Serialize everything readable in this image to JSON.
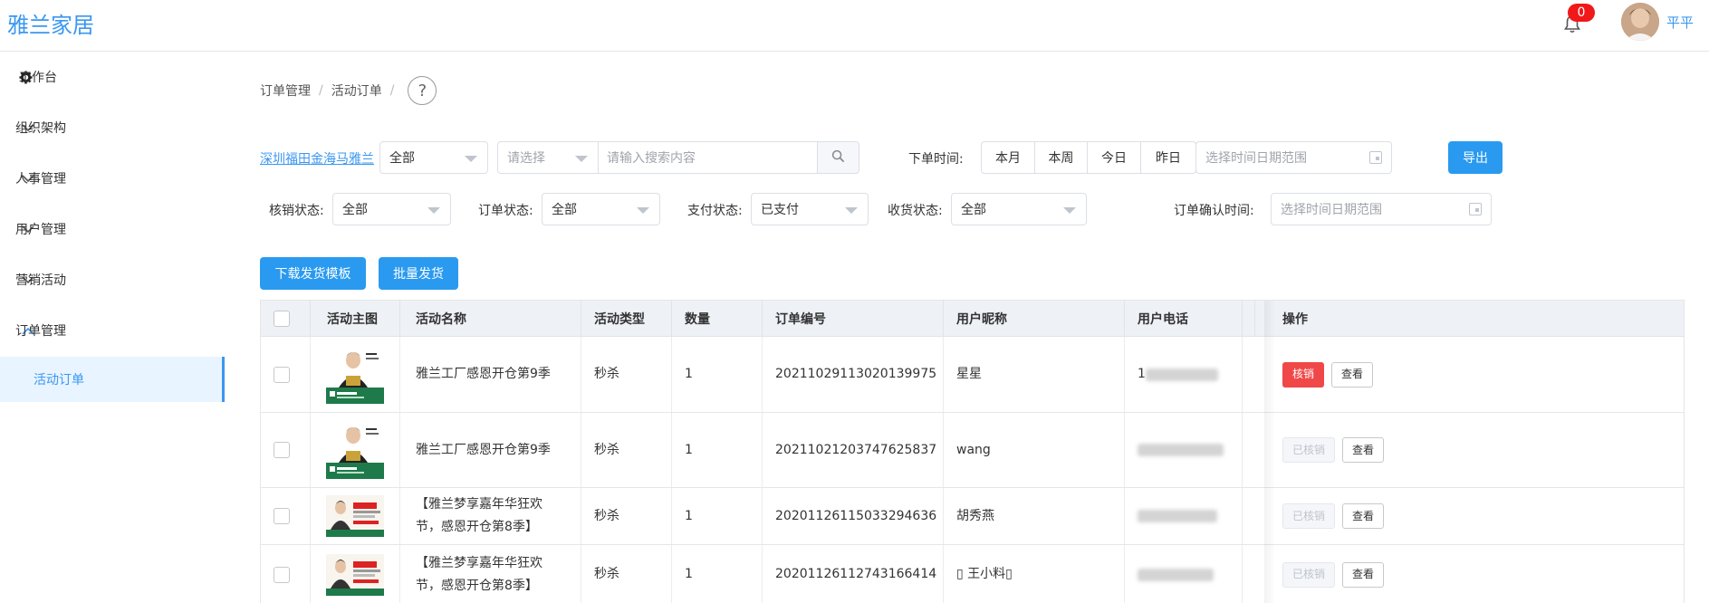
{
  "app": {
    "title": "雅兰家居",
    "notifications": "0",
    "user_name": "平平"
  },
  "sidebar": {
    "workbench": "工作台",
    "items": [
      {
        "label": "组织架构"
      },
      {
        "label": "人事管理"
      },
      {
        "label": "用户管理"
      },
      {
        "label": "营销活动"
      },
      {
        "label": "订单管理"
      }
    ],
    "active_sub": "活动订单"
  },
  "breadcrumb": [
    "订单管理",
    "活动订单"
  ],
  "filters": {
    "store_link": "深圳福田金海马雅兰",
    "select_all": "全部",
    "select_placeholder": "请选择",
    "search_placeholder": "请输入搜索内容",
    "order_time_label": "下单时间:",
    "time_buttons": [
      "本月",
      "本周",
      "今日",
      "昨日"
    ],
    "date_placeholder": "选择时间日期范围",
    "export": "导出",
    "writeoff_label": "核销状态:",
    "writeoff_value": "全部",
    "order_status_label": "订单状态:",
    "order_status_value": "全部",
    "pay_status_label": "支付状态:",
    "pay_status_value": "已支付",
    "receive_status_label": "收货状态:",
    "receive_status_value": "全部",
    "confirm_time_label": "订单确认时间:",
    "confirm_time_placeholder": "选择时间日期范围"
  },
  "actions": {
    "download_template": "下载发货模板",
    "batch_ship": "批量发货"
  },
  "table": {
    "headers": [
      "活动主图",
      "活动名称",
      "活动类型",
      "数量",
      "订单编号",
      "用户昵称",
      "用户电话",
      "操作"
    ],
    "rows": [
      {
        "name": "雅兰工厂感恩开仓第9季",
        "name2": "",
        "type": "秒杀",
        "qty": "1",
        "order_no": "20211029113020139975",
        "nickname": "星星",
        "phone_visible": "1",
        "writeoff": "核销",
        "writeoff_state": "active",
        "view": "查看"
      },
      {
        "name": "雅兰工厂感恩开仓第9季",
        "name2": "",
        "type": "秒杀",
        "qty": "1",
        "order_no": "20211021203747625837",
        "nickname": "wang",
        "phone_visible": "",
        "writeoff": "已核销",
        "writeoff_state": "disabled",
        "view": "查看"
      },
      {
        "name": "【雅兰梦享嘉年华狂欢",
        "name2": "节，感恩开仓第8季】",
        "type": "秒杀",
        "qty": "1",
        "order_no": "20201126115033294636",
        "nickname": "胡秀燕",
        "phone_visible": "",
        "writeoff": "已核销",
        "writeoff_state": "disabled",
        "view": "查看"
      },
      {
        "name": "【雅兰梦享嘉年华狂欢",
        "name2": "节，感恩开仓第8季】",
        "type": "秒杀",
        "qty": "1",
        "order_no": "20201126112743166414",
        "nickname": "▯ 王小料▯",
        "phone_visible": "",
        "writeoff": "已核销",
        "writeoff_state": "disabled",
        "view": "查看"
      }
    ]
  },
  "colors": {
    "primary": "#2a9af0",
    "danger": "#f04848",
    "brand": "#3a97f0"
  }
}
